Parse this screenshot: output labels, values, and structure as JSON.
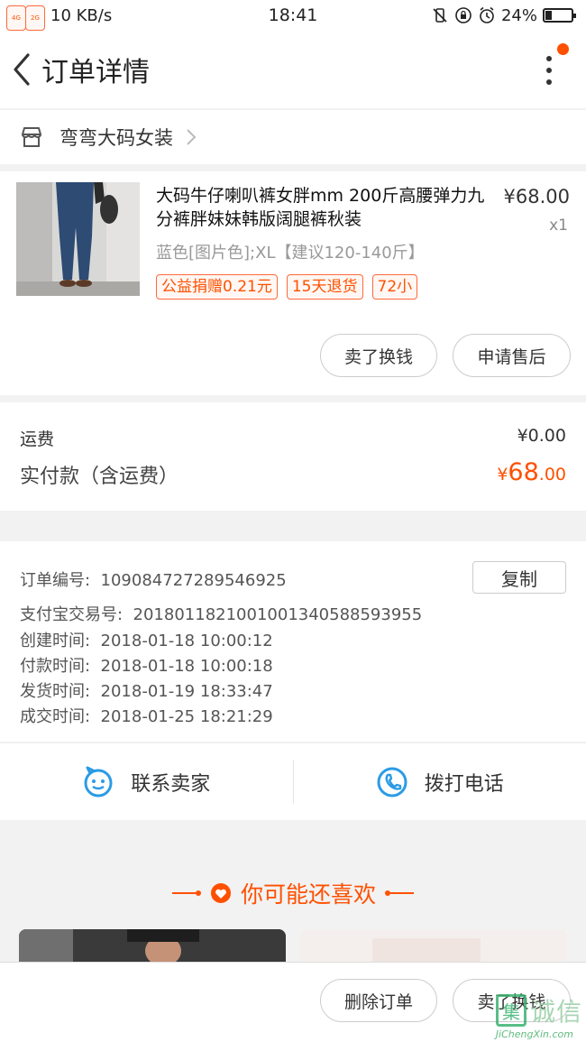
{
  "status_bar": {
    "net_speed": "10 KB/s",
    "signal_tag1": "4G",
    "signal_tag2": "2G",
    "time": "18:41",
    "battery": "24%",
    "battery_level": 0.24
  },
  "header": {
    "title": "订单详情",
    "badge_color": "#ff5000"
  },
  "shop": {
    "name": "弯弯大码女装"
  },
  "product": {
    "title": "大码牛仔喇叭裤女胖mm 200斤高腰弹力九分裤胖妹妹韩版阔腿裤秋装",
    "price": "¥68.00",
    "qty": "x1",
    "spec": "蓝色[图片色];XL【建议120-140斤】",
    "tags": [
      "公益捐赠0.21元",
      "15天退货",
      "72小"
    ],
    "actions": [
      "卖了换钱",
      "申请售后"
    ]
  },
  "summary": {
    "shipping_label": "运费",
    "shipping_value": "¥0.00",
    "paid_label": "实付款（含运费）",
    "paid_currency": "¥",
    "paid_int": "68",
    "paid_dec": ".00"
  },
  "order_info": {
    "copy_label": "复制",
    "lines": [
      {
        "label": "订单编号:",
        "value": "109084727289546925"
      },
      {
        "label": "支付宝交易号:",
        "value": "2018011821001001340588593955"
      },
      {
        "label": "创建时间:",
        "value": "2018-01-18 10:00:12"
      },
      {
        "label": "付款时间:",
        "value": "2018-01-18 10:00:18"
      },
      {
        "label": "发货时间:",
        "value": "2018-01-19 18:33:47"
      },
      {
        "label": "成交时间:",
        "value": "2018-01-25 18:21:29"
      }
    ]
  },
  "contact": {
    "seller_label": "联系卖家",
    "phone_label": "拨打电话"
  },
  "recommend": {
    "title": "你可能还喜欢"
  },
  "bottom": {
    "actions": [
      "删除订单",
      "卖了换钱"
    ]
  },
  "watermark": {
    "chars": "诚信",
    "box_char": "集",
    "sub": "JiChengXin.com"
  },
  "colors": {
    "accent": "#ff5000",
    "icon_blue": "#2b9be6"
  }
}
